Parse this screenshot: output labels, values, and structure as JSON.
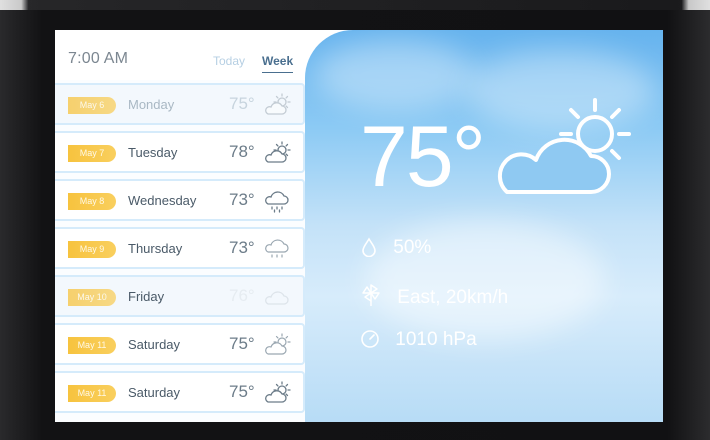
{
  "header": {
    "time": "7:00 AM",
    "tabs": [
      {
        "label": "Today",
        "active": false
      },
      {
        "label": "Week",
        "active": true
      }
    ]
  },
  "forecast": [
    {
      "date": "May 6",
      "day": "Monday",
      "temp": "75°",
      "icon": "partly-cloudy-icon",
      "state": "dim"
    },
    {
      "date": "May 7",
      "day": "Tuesday",
      "temp": "78°",
      "icon": "partly-cloudy-icon",
      "state": "normal"
    },
    {
      "date": "May 8",
      "day": "Wednesday",
      "temp": "73°",
      "icon": "rain-cloud-icon",
      "state": "normal"
    },
    {
      "date": "May 9",
      "day": "Thursday",
      "temp": "73°",
      "icon": "rain-cloud-icon",
      "state": "normal"
    },
    {
      "date": "May 10",
      "day": "Friday",
      "temp": "76°",
      "icon": "cloud-icon",
      "state": "ghost"
    },
    {
      "date": "May 11",
      "day": "Saturday",
      "temp": "75°",
      "icon": "partly-cloudy-icon",
      "state": "normal"
    },
    {
      "date": "May 11",
      "day": "Saturday",
      "temp": "75°",
      "icon": "partly-cloudy-icon",
      "state": "normal"
    }
  ],
  "current": {
    "temp": "75°",
    "icon": "partly-cloudy-icon",
    "humidity": "50%",
    "wind": "East, 20km/h",
    "pressure": "1010 hPa"
  },
  "colors": {
    "badge": "#f7c33e",
    "accent": "#4a6f8f",
    "sky_top": "#66b3ee",
    "sky_bottom": "#d7ecfb"
  }
}
